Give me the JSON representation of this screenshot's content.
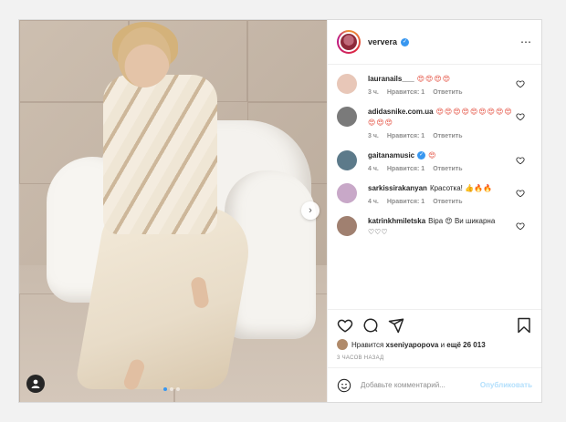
{
  "post": {
    "author": "ververa",
    "verified": true,
    "more_icon": "⋯"
  },
  "comments": [
    {
      "user": "lauranails___",
      "text": "😍😍😍😍",
      "time": "3 ч.",
      "likes": "Нравится: 1",
      "reply": "Ответить",
      "avatar_color": "#e8c7b8"
    },
    {
      "user": "adidasnike.com.ua",
      "text": "😍😍😍😍😍😍😍😍😍😍😍😍",
      "time": "3 ч.",
      "likes": "Нравится: 1",
      "reply": "Ответить",
      "avatar_color": "#7a7a7a"
    },
    {
      "user": "gaitanamusic",
      "text": "😍",
      "time": "4 ч.",
      "likes": "Нравится: 1",
      "reply": "Ответить",
      "avatar_color": "#5c7a8a",
      "verified": true
    },
    {
      "user": "sarkissirakanyan",
      "text": "Красотка! 👍🔥🔥",
      "time": "4 ч.",
      "likes": "Нравится: 1",
      "reply": "Ответить",
      "avatar_color": "#c8a8c8"
    },
    {
      "user": "katrinkhmiletska",
      "text": "Віра 😍 Ви шикарна ♡♡♡",
      "time": "",
      "likes": "",
      "reply": "",
      "avatar_color": "#a08070"
    }
  ],
  "likes": {
    "prefix": "Нравится",
    "user": "xseniyapopova",
    "conjunction": "и",
    "count": "ещё 26 013"
  },
  "timestamp": "3 ЧАСОВ НАЗАД",
  "add_comment": {
    "placeholder": "Добавьте комментарий...",
    "publish": "Опубликовать"
  },
  "icons": {
    "heart": "heart-icon",
    "comment": "comment-icon",
    "share": "share-icon",
    "save": "bookmark-icon",
    "emoji": "emoji-icon",
    "next": "chevron-right-icon",
    "tag": "user-tag-icon"
  },
  "colors": {
    "link": "#3897f0",
    "publish_disabled": "#b2dffc",
    "muted": "#8e8e8e"
  },
  "carousel": {
    "current": 1,
    "total": 3
  }
}
